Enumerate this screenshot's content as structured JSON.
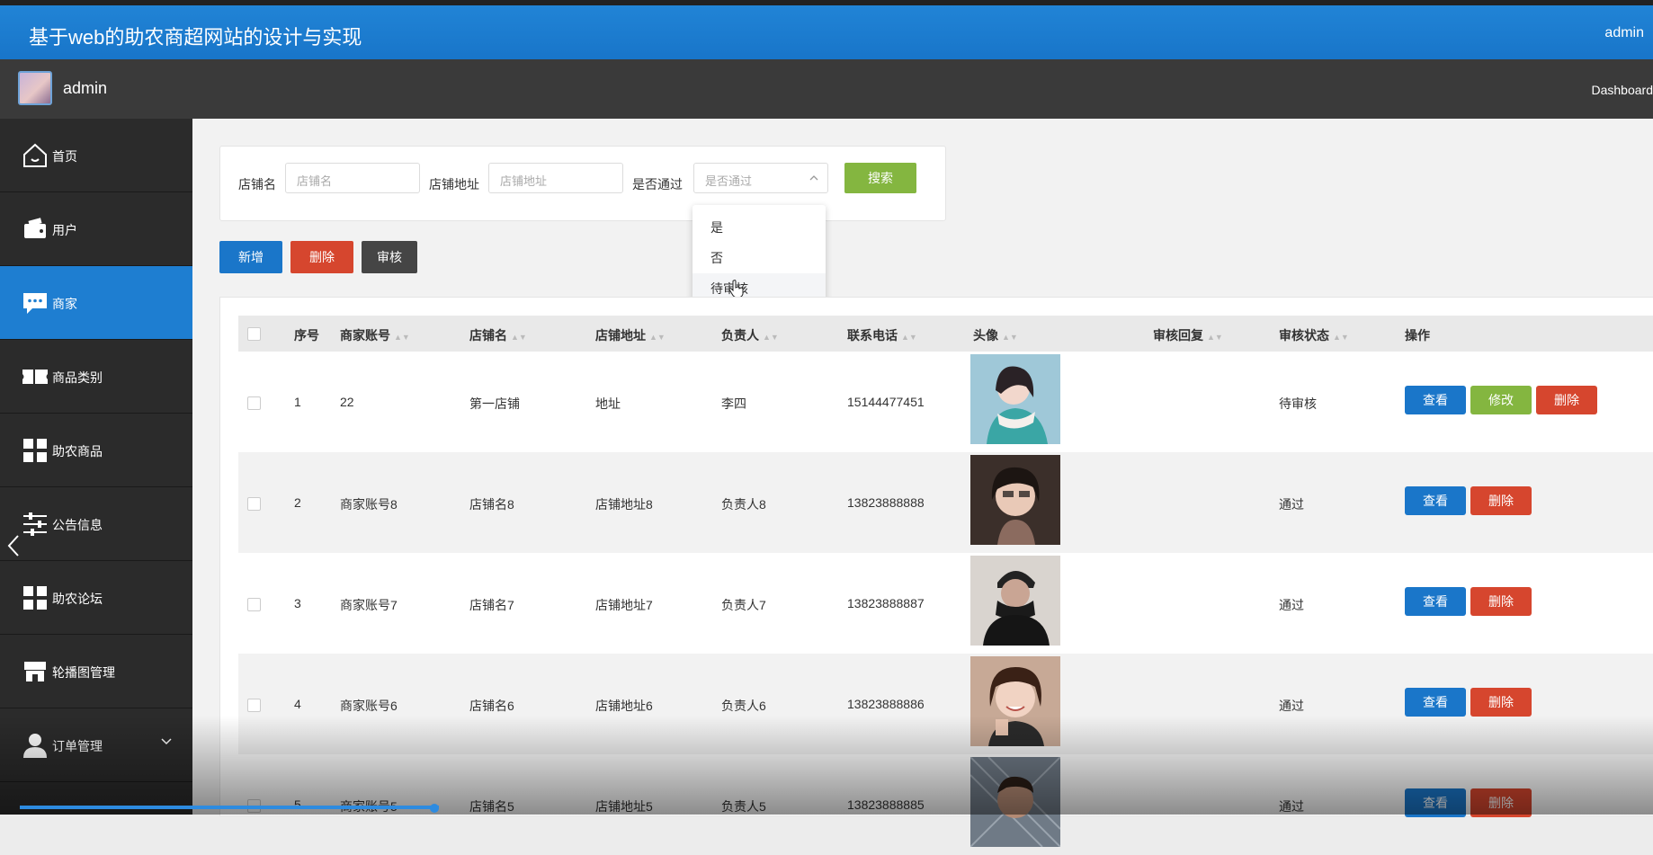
{
  "header": {
    "title": "基于web的助农商超网站的设计与实现",
    "user": "admin"
  },
  "userbar": {
    "name": "admin",
    "breadcrumb": "Dashboard"
  },
  "sidebar": {
    "items": [
      {
        "label": "首页",
        "icon": "home-icon"
      },
      {
        "label": "用户",
        "icon": "wallet-icon"
      },
      {
        "label": "商家",
        "icon": "chat-icon"
      },
      {
        "label": "商品类别",
        "icon": "ticket-icon"
      },
      {
        "label": "助农商品",
        "icon": "grid-icon"
      },
      {
        "label": "公告信息",
        "icon": "sliders-icon"
      },
      {
        "label": "助农论坛",
        "icon": "grid-icon"
      },
      {
        "label": "轮播图管理",
        "icon": "store-icon"
      },
      {
        "label": "订单管理",
        "icon": "user-icon"
      }
    ],
    "active_index": 2
  },
  "search": {
    "shop_name_label": "店铺名",
    "shop_name_placeholder": "店铺名",
    "shop_address_label": "店铺地址",
    "shop_address_placeholder": "店铺地址",
    "pass_label": "是否通过",
    "pass_placeholder": "是否通过",
    "search_button": "搜索",
    "pass_options": [
      "是",
      "否",
      "待审核"
    ]
  },
  "actions": {
    "add": "新增",
    "delete": "删除",
    "review": "审核"
  },
  "table": {
    "columns": [
      "序号",
      "商家账号",
      "店铺名",
      "店铺地址",
      "负责人",
      "联系电话",
      "头像",
      "审核回复",
      "审核状态",
      "操作"
    ],
    "rows": [
      {
        "index": "1",
        "account": "22",
        "shop": "第一店铺",
        "address": "地址",
        "owner": "李四",
        "phone": "15144477451",
        "reply": "",
        "status": "待审核",
        "buttons": [
          "查看",
          "修改",
          "删除"
        ]
      },
      {
        "index": "2",
        "account": "商家账号8",
        "shop": "店铺名8",
        "address": "店铺地址8",
        "owner": "负责人8",
        "phone": "13823888888",
        "reply": "",
        "status": "通过",
        "buttons": [
          "查看",
          "删除"
        ]
      },
      {
        "index": "3",
        "account": "商家账号7",
        "shop": "店铺名7",
        "address": "店铺地址7",
        "owner": "负责人7",
        "phone": "13823888887",
        "reply": "",
        "status": "通过",
        "buttons": [
          "查看",
          "删除"
        ]
      },
      {
        "index": "4",
        "account": "商家账号6",
        "shop": "店铺名6",
        "address": "店铺地址6",
        "owner": "负责人6",
        "phone": "13823888886",
        "reply": "",
        "status": "通过",
        "buttons": [
          "查看",
          "删除"
        ]
      },
      {
        "index": "5",
        "account": "商家账号5",
        "shop": "店铺名5",
        "address": "店铺地址5",
        "owner": "负责人5",
        "phone": "13823888885",
        "reply": "",
        "status": "通过",
        "buttons": [
          "查看",
          "删除"
        ]
      }
    ]
  }
}
